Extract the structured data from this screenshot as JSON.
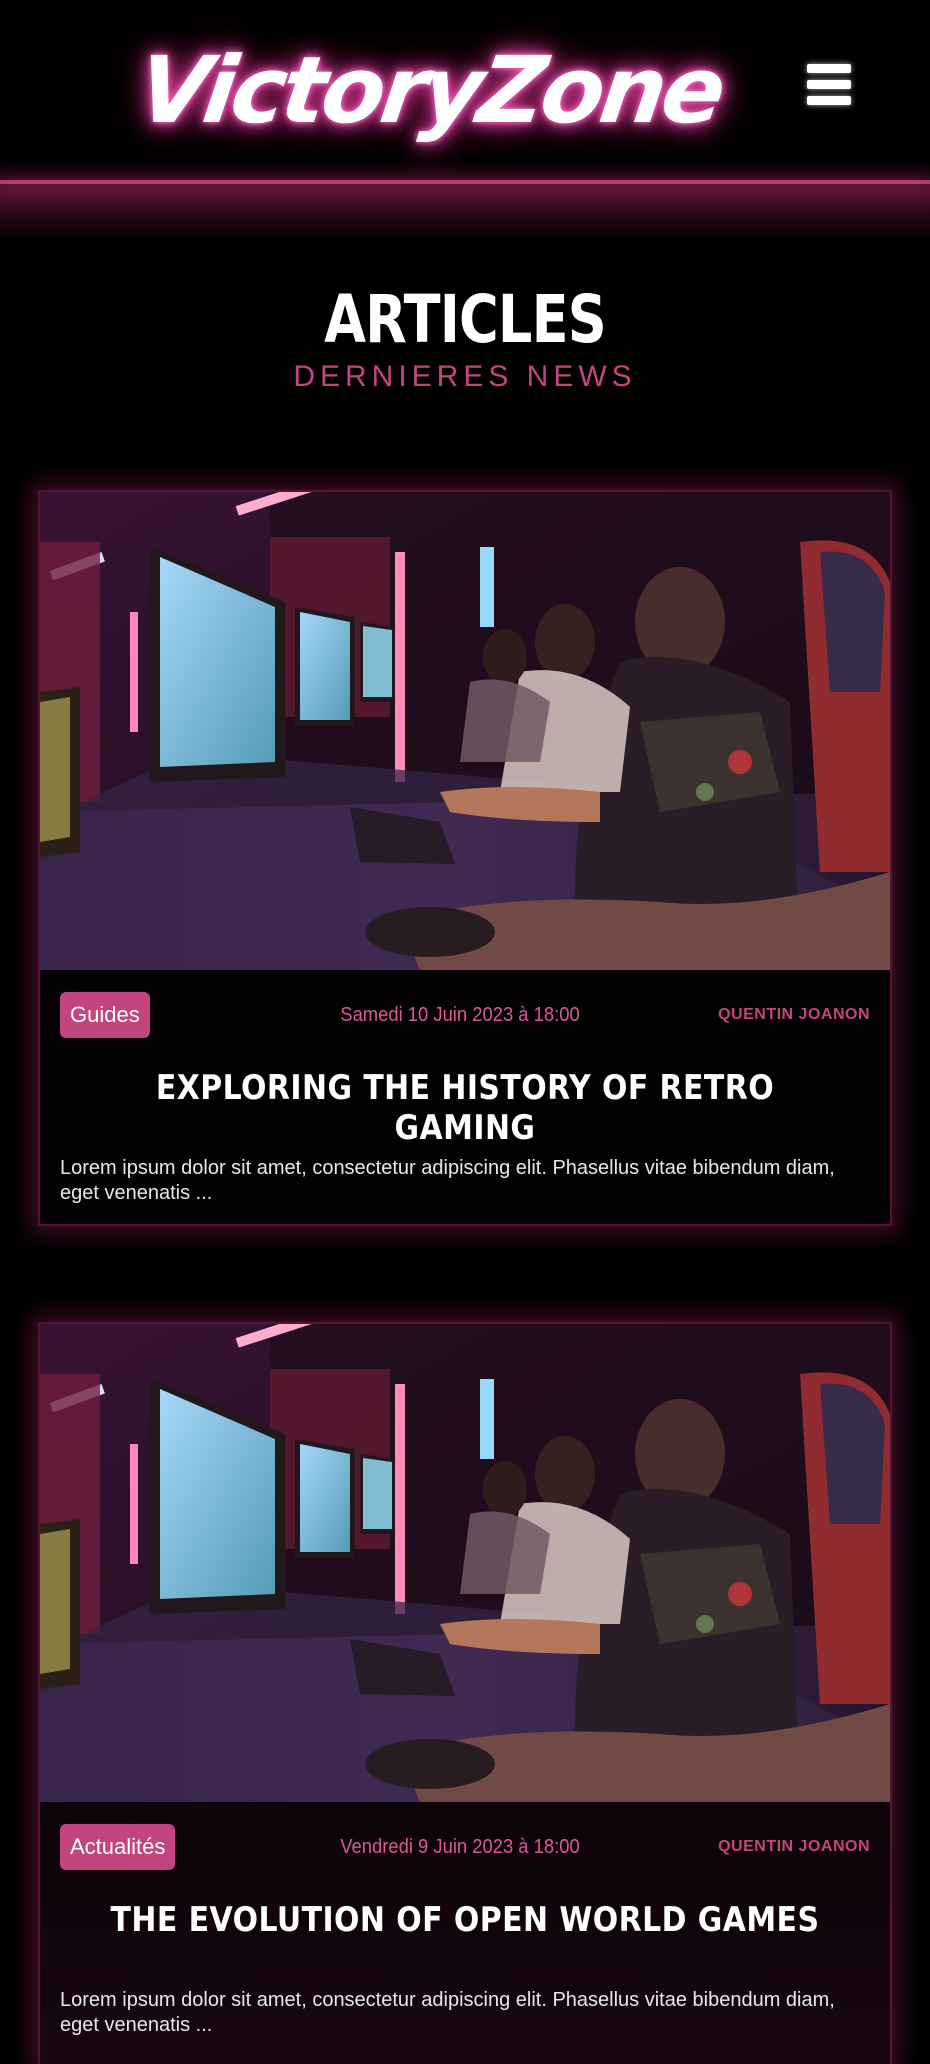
{
  "header": {
    "logo_text": "VictoryZone",
    "menu_icon": "hamburger-menu-icon"
  },
  "section": {
    "title": "ARTICLES",
    "subtitle": "DERNIERES NEWS"
  },
  "articles": [
    {
      "tag": "Guides",
      "date": "Samedi 10 Juin 2023 à 18:00",
      "author": "QUENTIN JOANON",
      "title": "EXPLORING THE HISTORY OF RETRO GAMING",
      "excerpt": "Lorem ipsum dolor sit amet, consectetur adipiscing elit. Phasellus vitae bibendum diam, eget venenatis ..."
    },
    {
      "tag": "Actualités",
      "date": "Vendredi 9 Juin 2023 à 18:00",
      "author": "QUENTIN JOANON",
      "title": "THE EVOLUTION OF OPEN WORLD GAMES",
      "excerpt": "Lorem ipsum dolor sit amet, consectetur adipiscing elit. Phasellus vitae bibendum diam, eget venenatis ..."
    }
  ],
  "colors": {
    "accent": "#c2457f",
    "accent_text": "#d85a98",
    "background": "#000000"
  }
}
